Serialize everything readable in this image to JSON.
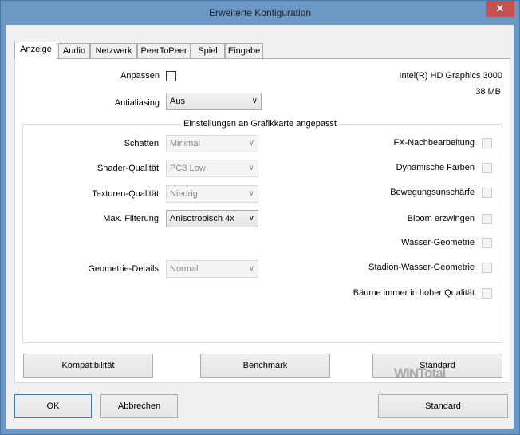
{
  "window": {
    "title": "Erweiterte Konfiguration",
    "close": "✕"
  },
  "tabs": [
    "Anzeige",
    "Audio",
    "Netzwerk",
    "PeerToPeer",
    "Spiel",
    "Eingabe"
  ],
  "top": {
    "anpassen_label": "Anpassen",
    "antialiasing_label": "Antialiasing",
    "antialiasing_value": "Aus",
    "gpu_name": "Intel(R) HD Graphics 3000",
    "gpu_memory": "38 MB"
  },
  "group": {
    "title": "Einstellungen an Grafikkarte angepasst",
    "selects": [
      {
        "label": "Schatten",
        "value": "Minimal",
        "enabled": false
      },
      {
        "label": "Shader-Qualität",
        "value": "PC3 Low",
        "enabled": false
      },
      {
        "label": "Texturen-Qualität",
        "value": "Niedrig",
        "enabled": false
      },
      {
        "label": "Max. Filterung",
        "value": "Anisotropisch 4x",
        "enabled": true
      },
      {
        "label": "Geometrie-Details",
        "value": "Normal",
        "enabled": false
      }
    ],
    "checkboxes": [
      "FX-Nachbearbeitung",
      "Dynamische Farben",
      "Bewegungsunschärfe",
      "Bloom erzwingen",
      "Wasser-Geometrie",
      "Stadion-Wasser-Geometrie",
      "Bäume immer in hoher Qualität"
    ]
  },
  "panel_buttons": {
    "compat": "Kompatibilität",
    "bench": "Benchmark",
    "standard": "Standard"
  },
  "footer": {
    "ok": "OK",
    "cancel": "Abbrechen",
    "standard": "Standard"
  },
  "watermark": "WINTotal"
}
